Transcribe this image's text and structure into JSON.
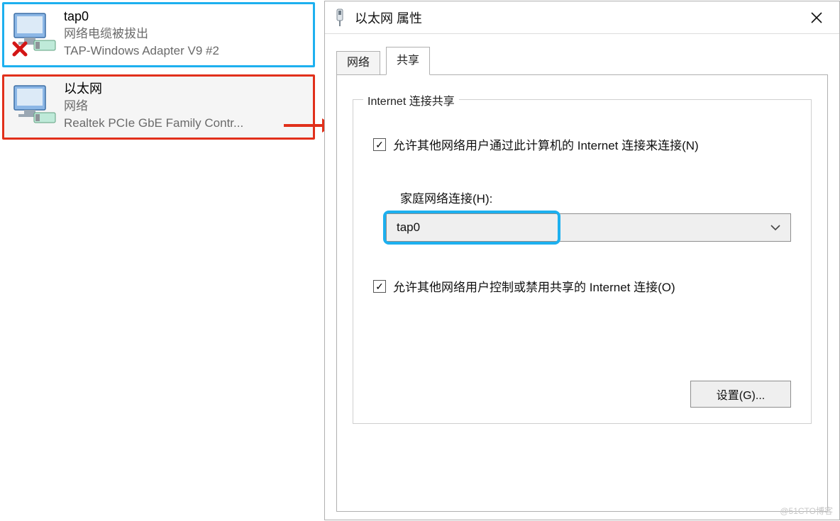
{
  "adapters": [
    {
      "name": "tap0",
      "status": "网络电缆被拔出",
      "device": "TAP-Windows Adapter V9 #2",
      "disconnected": true,
      "highlight": "blue"
    },
    {
      "name": "以太网",
      "status": "网络",
      "device": "Realtek PCIe GbE Family Contr...",
      "disconnected": false,
      "highlight": "red"
    }
  ],
  "dialog": {
    "title": "以太网 属性",
    "tabs": {
      "network": "网络",
      "sharing": "共享",
      "active": "sharing"
    },
    "group_legend": "Internet 连接共享",
    "allow_share": {
      "label": "允许其他网络用户通过此计算机的 Internet 连接来连接(N)",
      "checked": true
    },
    "home_net_label": "家庭网络连接(H):",
    "home_net_value": "tap0",
    "allow_control": {
      "label": "允许其他网络用户控制或禁用共享的 Internet 连接(O)",
      "checked": true
    },
    "settings_button": "设置(G)..."
  },
  "watermark": "@51CTO博客"
}
